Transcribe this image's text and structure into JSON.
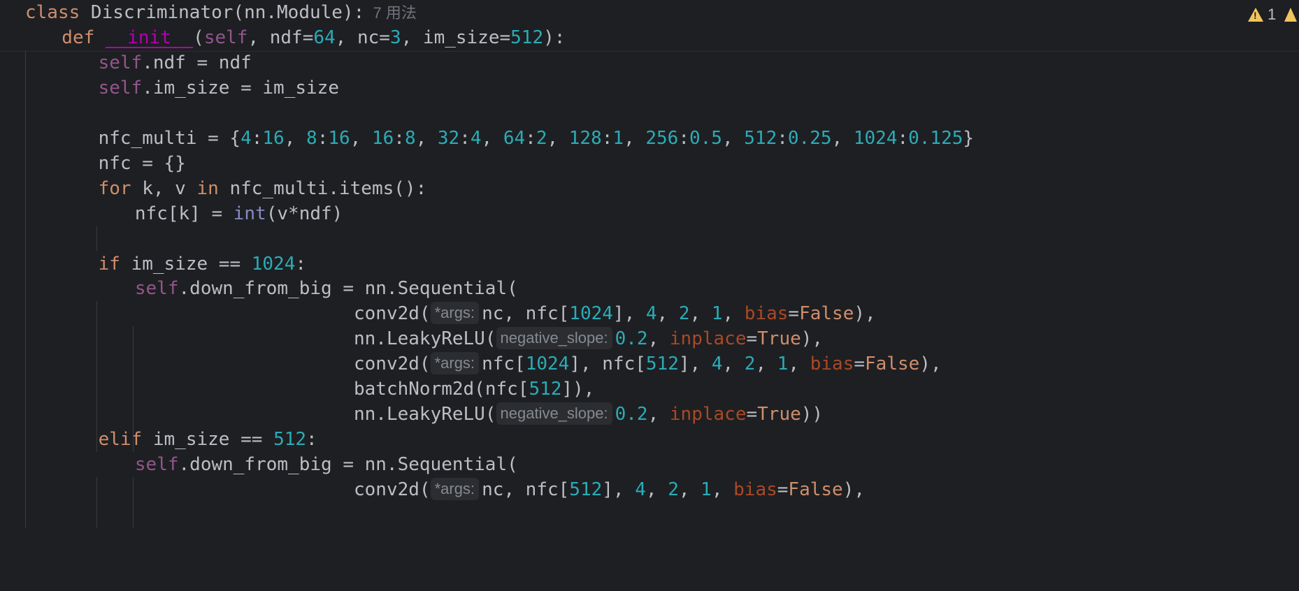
{
  "editor": {
    "language": "python",
    "class_usages": "7 用法",
    "warning_count": "1",
    "lines": [
      {
        "indent": 0,
        "tokens": [
          {
            "t": "class ",
            "c": "kw"
          },
          {
            "t": "Discriminator(nn.Module):",
            "c": ""
          },
          {
            "t": "  7 用法",
            "c": "usages"
          }
        ]
      },
      {
        "indent": 1,
        "tokens": [
          {
            "t": "def ",
            "c": "kw"
          },
          {
            "t": "__init__",
            "c": "dund"
          },
          {
            "t": "(",
            "c": ""
          },
          {
            "t": "self",
            "c": "self"
          },
          {
            "t": ", ndf=",
            "c": ""
          },
          {
            "t": "64",
            "c": "num"
          },
          {
            "t": ", nc=",
            "c": ""
          },
          {
            "t": "3",
            "c": "num"
          },
          {
            "t": ", im_size=",
            "c": ""
          },
          {
            "t": "512",
            "c": "num"
          },
          {
            "t": "):",
            "c": ""
          }
        ]
      },
      {
        "indent": 2,
        "tokens": [
          {
            "t": "self",
            "c": "self"
          },
          {
            "t": ".ndf = ndf",
            "c": ""
          }
        ]
      },
      {
        "indent": 2,
        "tokens": [
          {
            "t": "self",
            "c": "self"
          },
          {
            "t": ".im_size = im_size",
            "c": ""
          }
        ]
      },
      {
        "indent": 2,
        "tokens": []
      },
      {
        "indent": 2,
        "tokens": [
          {
            "t": "nfc_multi = {",
            "c": ""
          },
          {
            "t": "4",
            "c": "num"
          },
          {
            "t": ":",
            "c": ""
          },
          {
            "t": "16",
            "c": "num"
          },
          {
            "t": ", ",
            "c": ""
          },
          {
            "t": "8",
            "c": "num"
          },
          {
            "t": ":",
            "c": ""
          },
          {
            "t": "16",
            "c": "num"
          },
          {
            "t": ", ",
            "c": ""
          },
          {
            "t": "16",
            "c": "num"
          },
          {
            "t": ":",
            "c": ""
          },
          {
            "t": "8",
            "c": "num"
          },
          {
            "t": ", ",
            "c": ""
          },
          {
            "t": "32",
            "c": "num"
          },
          {
            "t": ":",
            "c": ""
          },
          {
            "t": "4",
            "c": "num"
          },
          {
            "t": ", ",
            "c": ""
          },
          {
            "t": "64",
            "c": "num"
          },
          {
            "t": ":",
            "c": ""
          },
          {
            "t": "2",
            "c": "num"
          },
          {
            "t": ", ",
            "c": ""
          },
          {
            "t": "128",
            "c": "num"
          },
          {
            "t": ":",
            "c": ""
          },
          {
            "t": "1",
            "c": "num"
          },
          {
            "t": ", ",
            "c": ""
          },
          {
            "t": "256",
            "c": "num"
          },
          {
            "t": ":",
            "c": ""
          },
          {
            "t": "0.5",
            "c": "num"
          },
          {
            "t": ", ",
            "c": ""
          },
          {
            "t": "512",
            "c": "num"
          },
          {
            "t": ":",
            "c": ""
          },
          {
            "t": "0.25",
            "c": "num"
          },
          {
            "t": ", ",
            "c": ""
          },
          {
            "t": "1024",
            "c": "num"
          },
          {
            "t": ":",
            "c": ""
          },
          {
            "t": "0.125",
            "c": "num"
          },
          {
            "t": "}",
            "c": ""
          }
        ]
      },
      {
        "indent": 2,
        "tokens": [
          {
            "t": "nfc = {}",
            "c": ""
          }
        ]
      },
      {
        "indent": 2,
        "tokens": [
          {
            "t": "for ",
            "c": "kw"
          },
          {
            "t": "k, v ",
            "c": ""
          },
          {
            "t": "in ",
            "c": "kw"
          },
          {
            "t": "nfc_multi.items():",
            "c": ""
          }
        ]
      },
      {
        "indent": 3,
        "tokens": [
          {
            "t": "nfc[k] = ",
            "c": ""
          },
          {
            "t": "int",
            "c": "bi"
          },
          {
            "t": "(v*ndf)",
            "c": ""
          }
        ]
      },
      {
        "indent": 2,
        "tokens": []
      },
      {
        "indent": 2,
        "tokens": [
          {
            "t": "if ",
            "c": "kw"
          },
          {
            "t": "im_size == ",
            "c": ""
          },
          {
            "t": "1024",
            "c": "num"
          },
          {
            "t": ":",
            "c": ""
          }
        ]
      },
      {
        "indent": 3,
        "tokens": [
          {
            "t": "self",
            "c": "self"
          },
          {
            "t": ".down_from_big = nn.Sequential(",
            "c": ""
          }
        ]
      },
      {
        "indent": 9,
        "tokens": [
          {
            "t": "conv2d(",
            "c": ""
          },
          {
            "t": "*args:",
            "c": "hint"
          },
          {
            "t": "nc, nfc[",
            "c": ""
          },
          {
            "t": "1024",
            "c": "num"
          },
          {
            "t": "], ",
            "c": ""
          },
          {
            "t": "4",
            "c": "num"
          },
          {
            "t": ", ",
            "c": ""
          },
          {
            "t": "2",
            "c": "num"
          },
          {
            "t": ", ",
            "c": ""
          },
          {
            "t": "1",
            "c": "num"
          },
          {
            "t": ", ",
            "c": ""
          },
          {
            "t": "bias",
            "c": "named"
          },
          {
            "t": "=",
            "c": ""
          },
          {
            "t": "False",
            "c": "kw"
          },
          {
            "t": "),",
            "c": ""
          }
        ]
      },
      {
        "indent": 9,
        "tokens": [
          {
            "t": "nn.LeakyReLU(",
            "c": ""
          },
          {
            "t": "negative_slope:",
            "c": "hint"
          },
          {
            "t": "0.2",
            "c": "num"
          },
          {
            "t": ", ",
            "c": ""
          },
          {
            "t": "inplace",
            "c": "named"
          },
          {
            "t": "=",
            "c": ""
          },
          {
            "t": "True",
            "c": "kw"
          },
          {
            "t": "),",
            "c": ""
          }
        ]
      },
      {
        "indent": 9,
        "tokens": [
          {
            "t": "conv2d(",
            "c": ""
          },
          {
            "t": "*args:",
            "c": "hint"
          },
          {
            "t": "nfc[",
            "c": ""
          },
          {
            "t": "1024",
            "c": "num"
          },
          {
            "t": "], nfc[",
            "c": ""
          },
          {
            "t": "512",
            "c": "num"
          },
          {
            "t": "], ",
            "c": ""
          },
          {
            "t": "4",
            "c": "num"
          },
          {
            "t": ", ",
            "c": ""
          },
          {
            "t": "2",
            "c": "num"
          },
          {
            "t": ", ",
            "c": ""
          },
          {
            "t": "1",
            "c": "num"
          },
          {
            "t": ", ",
            "c": ""
          },
          {
            "t": "bias",
            "c": "named"
          },
          {
            "t": "=",
            "c": ""
          },
          {
            "t": "False",
            "c": "kw"
          },
          {
            "t": "),",
            "c": ""
          }
        ]
      },
      {
        "indent": 9,
        "tokens": [
          {
            "t": "batchNorm2d(nfc[",
            "c": ""
          },
          {
            "t": "512",
            "c": "num"
          },
          {
            "t": "]),",
            "c": ""
          }
        ]
      },
      {
        "indent": 9,
        "tokens": [
          {
            "t": "nn.LeakyReLU(",
            "c": ""
          },
          {
            "t": "negative_slope:",
            "c": "hint"
          },
          {
            "t": "0.2",
            "c": "num"
          },
          {
            "t": ", ",
            "c": ""
          },
          {
            "t": "inplace",
            "c": "named"
          },
          {
            "t": "=",
            "c": ""
          },
          {
            "t": "True",
            "c": "kw"
          },
          {
            "t": "))",
            "c": ""
          }
        ]
      },
      {
        "indent": 2,
        "tokens": [
          {
            "t": "elif ",
            "c": "kw"
          },
          {
            "t": "im_size == ",
            "c": ""
          },
          {
            "t": "512",
            "c": "num"
          },
          {
            "t": ":",
            "c": ""
          }
        ]
      },
      {
        "indent": 3,
        "tokens": [
          {
            "t": "self",
            "c": "self"
          },
          {
            "t": ".down_from_big = nn.Sequential(",
            "c": ""
          }
        ]
      },
      {
        "indent": 9,
        "tokens": [
          {
            "t": "conv2d(",
            "c": ""
          },
          {
            "t": "*args:",
            "c": "hint"
          },
          {
            "t": "nc, nfc[",
            "c": ""
          },
          {
            "t": "512",
            "c": "num"
          },
          {
            "t": "], ",
            "c": ""
          },
          {
            "t": "4",
            "c": "num"
          },
          {
            "t": ", ",
            "c": ""
          },
          {
            "t": "2",
            "c": "num"
          },
          {
            "t": ", ",
            "c": ""
          },
          {
            "t": "1",
            "c": "num"
          },
          {
            "t": ", ",
            "c": ""
          },
          {
            "t": "bias",
            "c": "named"
          },
          {
            "t": "=",
            "c": ""
          },
          {
            "t": "False",
            "c": "kw"
          },
          {
            "t": "),",
            "c": ""
          }
        ]
      }
    ]
  },
  "colors": {
    "background": "#1e1f22",
    "keyword": "#cf8e6d",
    "number": "#2aacb8",
    "self": "#94558d",
    "named_arg": "#aa4926",
    "dunder": "#b200b2",
    "hint_bg": "#2b2d30",
    "warning": "#f2c55c"
  },
  "icons": {
    "warning": "warning-triangle-icon"
  }
}
